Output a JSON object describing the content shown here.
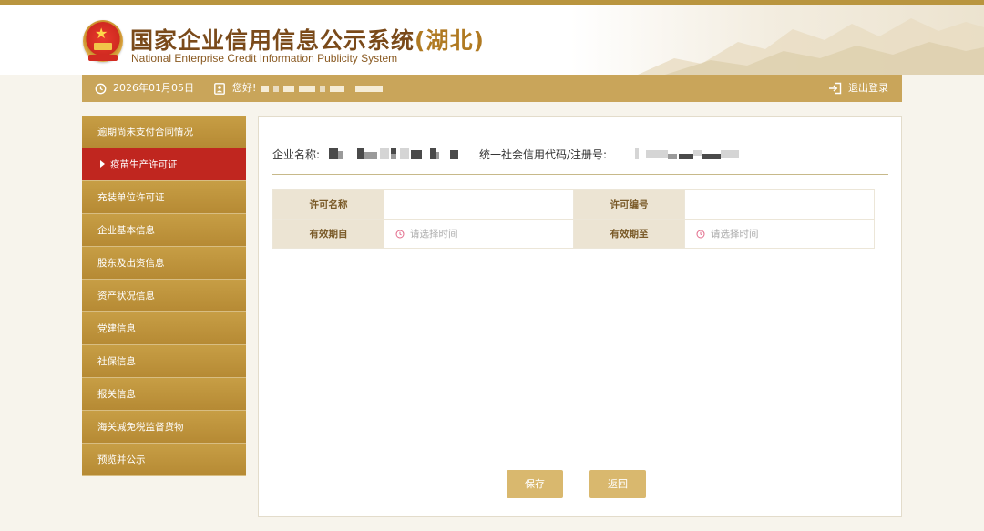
{
  "header": {
    "title_cn": "国家企业信用信息公示系统",
    "title_region": "(湖北)",
    "title_en": "National Enterprise Credit Information Publicity System",
    "emblem_icon": "national-emblem-icon"
  },
  "userbar": {
    "date": "2026年01月05日",
    "greeting": "您好!",
    "logout": "退出登录",
    "colors": {
      "bar": "#c9a55a"
    }
  },
  "sidebar": {
    "items": [
      {
        "label": "逾期尚未支付合同情况",
        "active": false
      },
      {
        "label": "疫苗生产许可证",
        "active": true
      },
      {
        "label": "充装单位许可证",
        "active": false
      },
      {
        "label": "企业基本信息",
        "active": false
      },
      {
        "label": "股东及出资信息",
        "active": false
      },
      {
        "label": "资产状况信息",
        "active": false
      },
      {
        "label": "党建信息",
        "active": false
      },
      {
        "label": "社保信息",
        "active": false
      },
      {
        "label": "报关信息",
        "active": false
      },
      {
        "label": "海关减免税监督货物",
        "active": false
      },
      {
        "label": "预览并公示",
        "active": false
      }
    ],
    "colors": {
      "normal": "#b68a34",
      "active": "#c0261f"
    }
  },
  "main": {
    "company_name_label": "企业名称:",
    "credit_code_label": "统一社会信用代码/注册号:",
    "form": {
      "license_name_label": "许可名称",
      "license_name_value": "",
      "license_no_label": "许可编号",
      "license_no_value": "",
      "valid_from_label": "有效期自",
      "valid_from_placeholder": "请选择时间",
      "valid_to_label": "有效期至",
      "valid_to_placeholder": "请选择时间"
    },
    "buttons": {
      "save": "保存",
      "back": "返回"
    }
  }
}
